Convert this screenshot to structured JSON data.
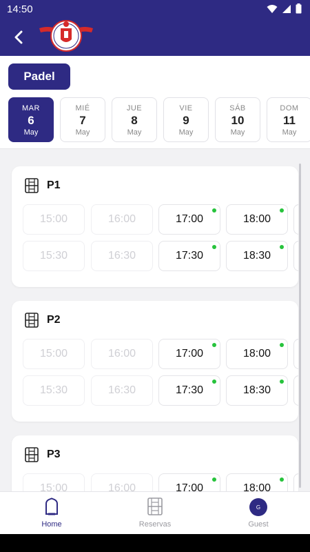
{
  "status": {
    "time": "14:50"
  },
  "header": {
    "logo_alt": "club-logo"
  },
  "sport": {
    "label": "Padel"
  },
  "days": [
    {
      "dow": "MAR",
      "num": "6",
      "mon": "May",
      "selected": true
    },
    {
      "dow": "MIÉ",
      "num": "7",
      "mon": "May",
      "selected": false
    },
    {
      "dow": "JUE",
      "num": "8",
      "mon": "May",
      "selected": false
    },
    {
      "dow": "VIE",
      "num": "9",
      "mon": "May",
      "selected": false
    },
    {
      "dow": "SÁB",
      "num": "10",
      "mon": "May",
      "selected": false
    },
    {
      "dow": "DOM",
      "num": "11",
      "mon": "May",
      "selected": false
    }
  ],
  "courts": [
    {
      "name": "P1",
      "rows": [
        [
          {
            "time": "15:00",
            "available": false
          },
          {
            "time": "16:00",
            "available": false
          },
          {
            "time": "17:00",
            "available": true
          },
          {
            "time": "18:00",
            "available": true
          }
        ],
        [
          {
            "time": "15:30",
            "available": false
          },
          {
            "time": "16:30",
            "available": false
          },
          {
            "time": "17:30",
            "available": true
          },
          {
            "time": "18:30",
            "available": true
          }
        ]
      ]
    },
    {
      "name": "P2",
      "rows": [
        [
          {
            "time": "15:00",
            "available": false
          },
          {
            "time": "16:00",
            "available": false
          },
          {
            "time": "17:00",
            "available": true
          },
          {
            "time": "18:00",
            "available": true
          }
        ],
        [
          {
            "time": "15:30",
            "available": false
          },
          {
            "time": "16:30",
            "available": false
          },
          {
            "time": "17:30",
            "available": true
          },
          {
            "time": "18:30",
            "available": true
          }
        ]
      ]
    },
    {
      "name": "P3",
      "rows": [
        [
          {
            "time": "15:00",
            "available": false
          },
          {
            "time": "16:00",
            "available": false
          },
          {
            "time": "17:00",
            "available": true
          },
          {
            "time": "18:00",
            "available": true
          }
        ]
      ]
    }
  ],
  "nav": {
    "home": "Home",
    "reservas": "Reservas",
    "guest": "Guest",
    "guest_initial": "G"
  },
  "colors": {
    "primary": "#2e2a83",
    "available_dot": "#27c33c"
  }
}
